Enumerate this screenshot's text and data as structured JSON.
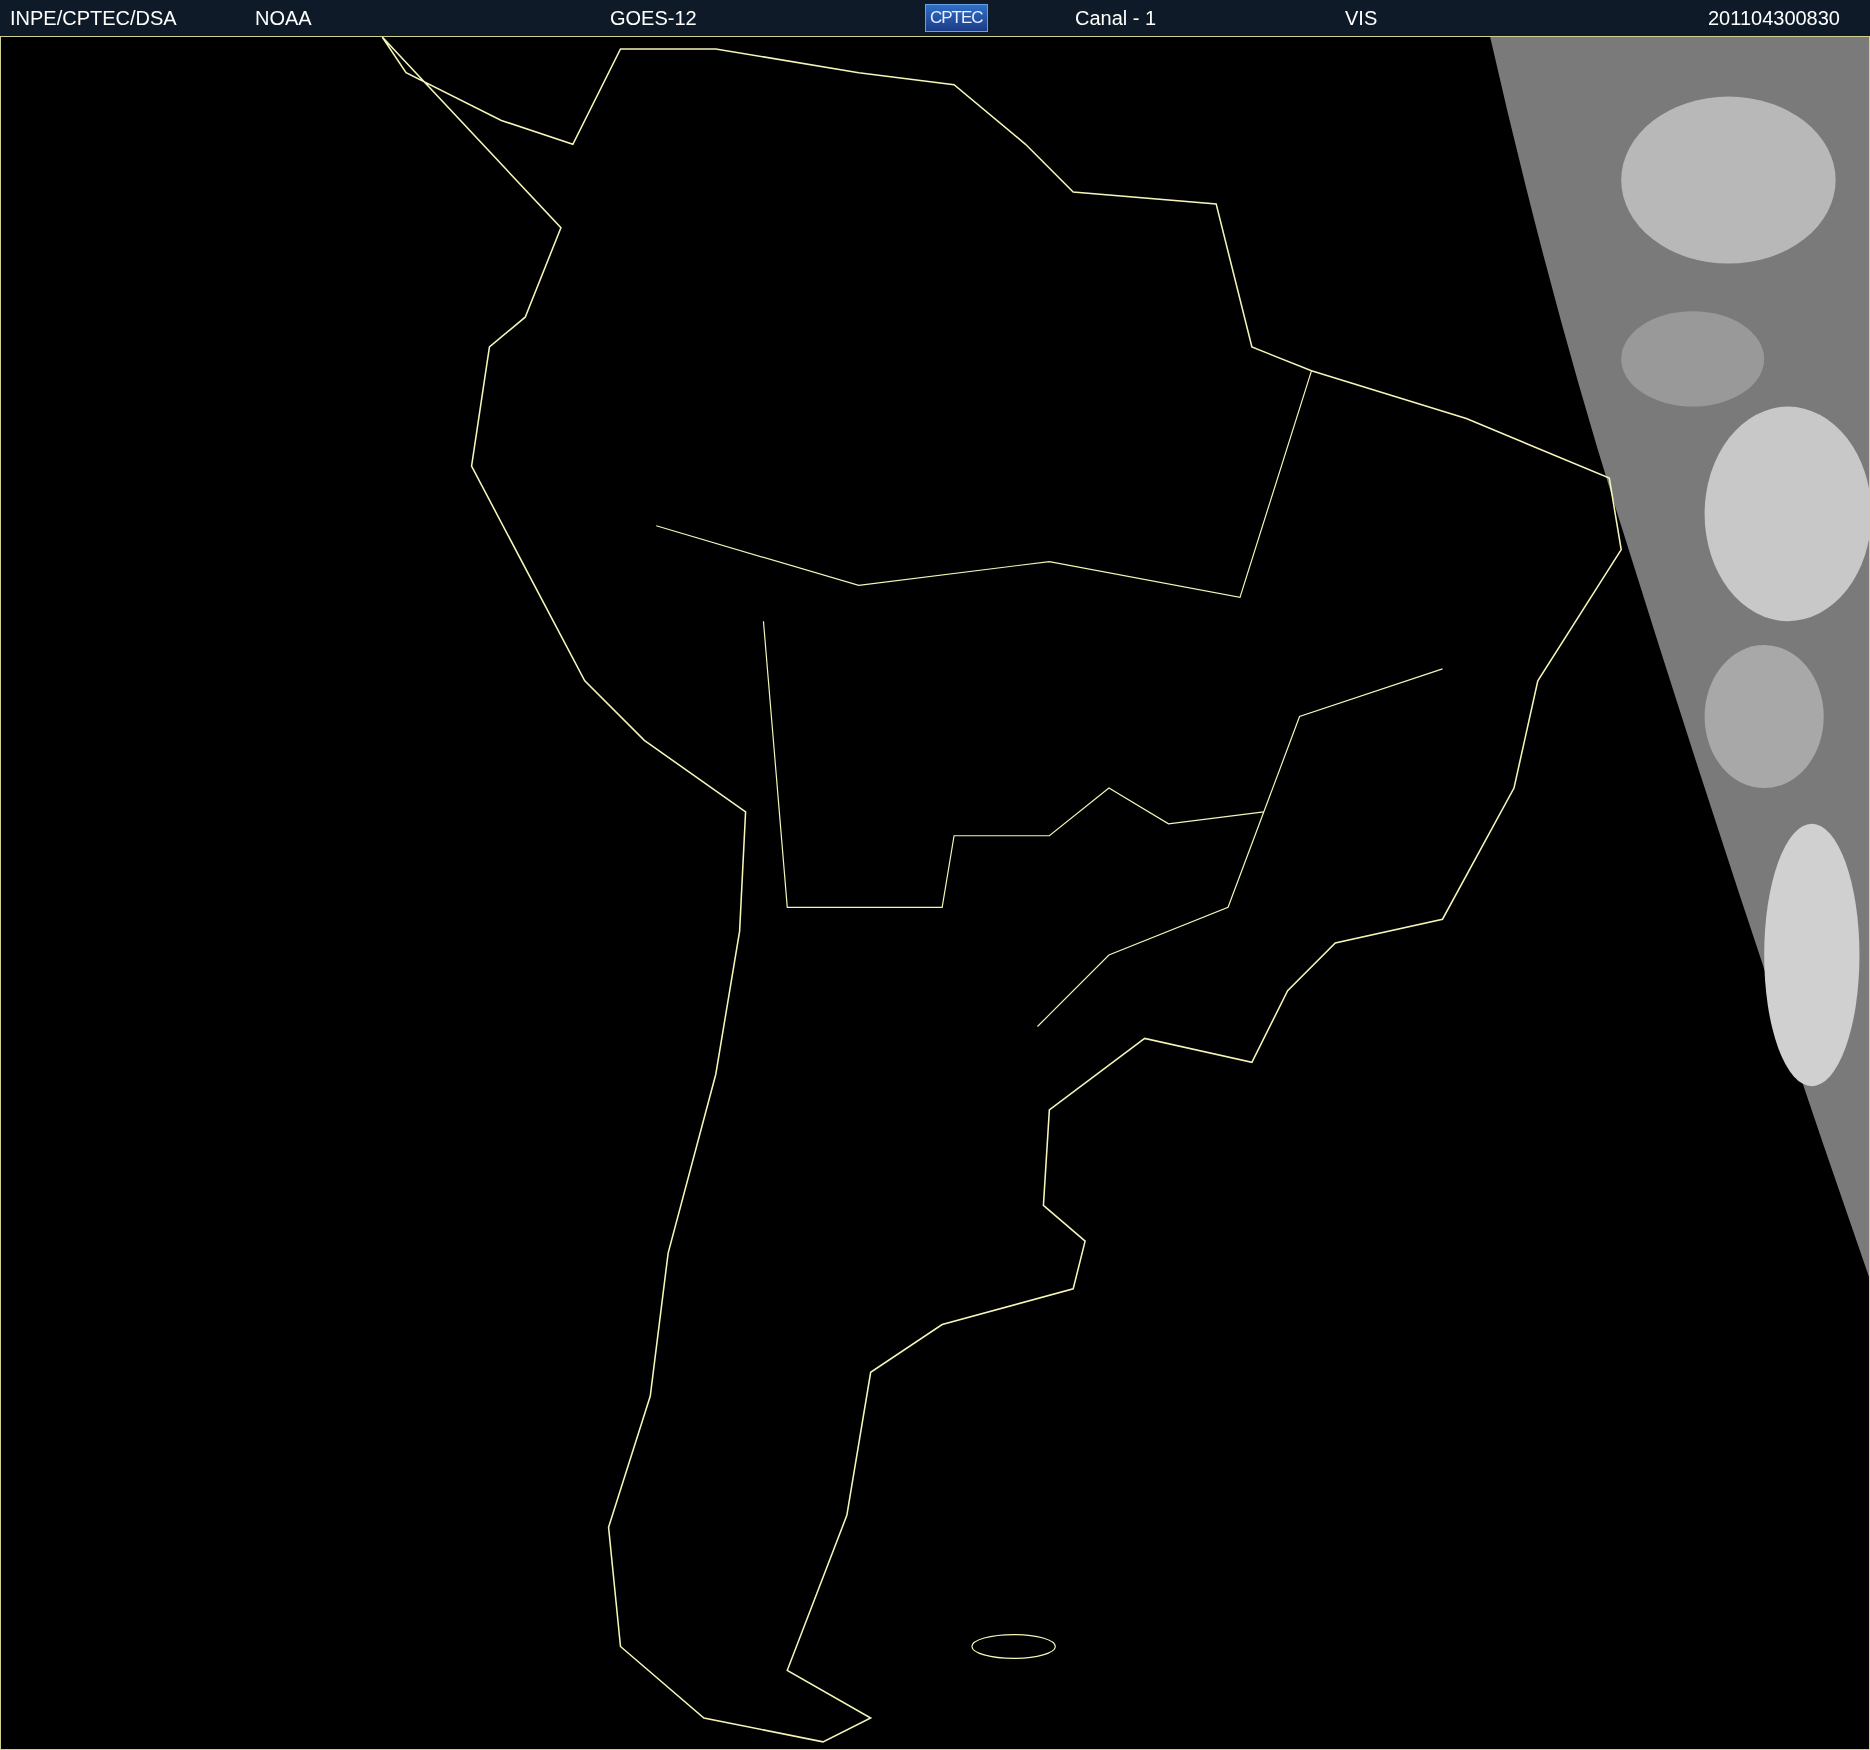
{
  "header": {
    "items": [
      {
        "kind": "text",
        "text": "INPE/CPTEC/DSA"
      },
      {
        "kind": "text",
        "text": "NOAA"
      },
      {
        "kind": "text",
        "text": "GOES-12"
      },
      {
        "kind": "logo",
        "text": "CPTEC"
      },
      {
        "kind": "text",
        "text": "Canal - 1"
      },
      {
        "kind": "text",
        "text": "VIS"
      },
      {
        "kind": "text",
        "text": "201104300830"
      }
    ]
  }
}
